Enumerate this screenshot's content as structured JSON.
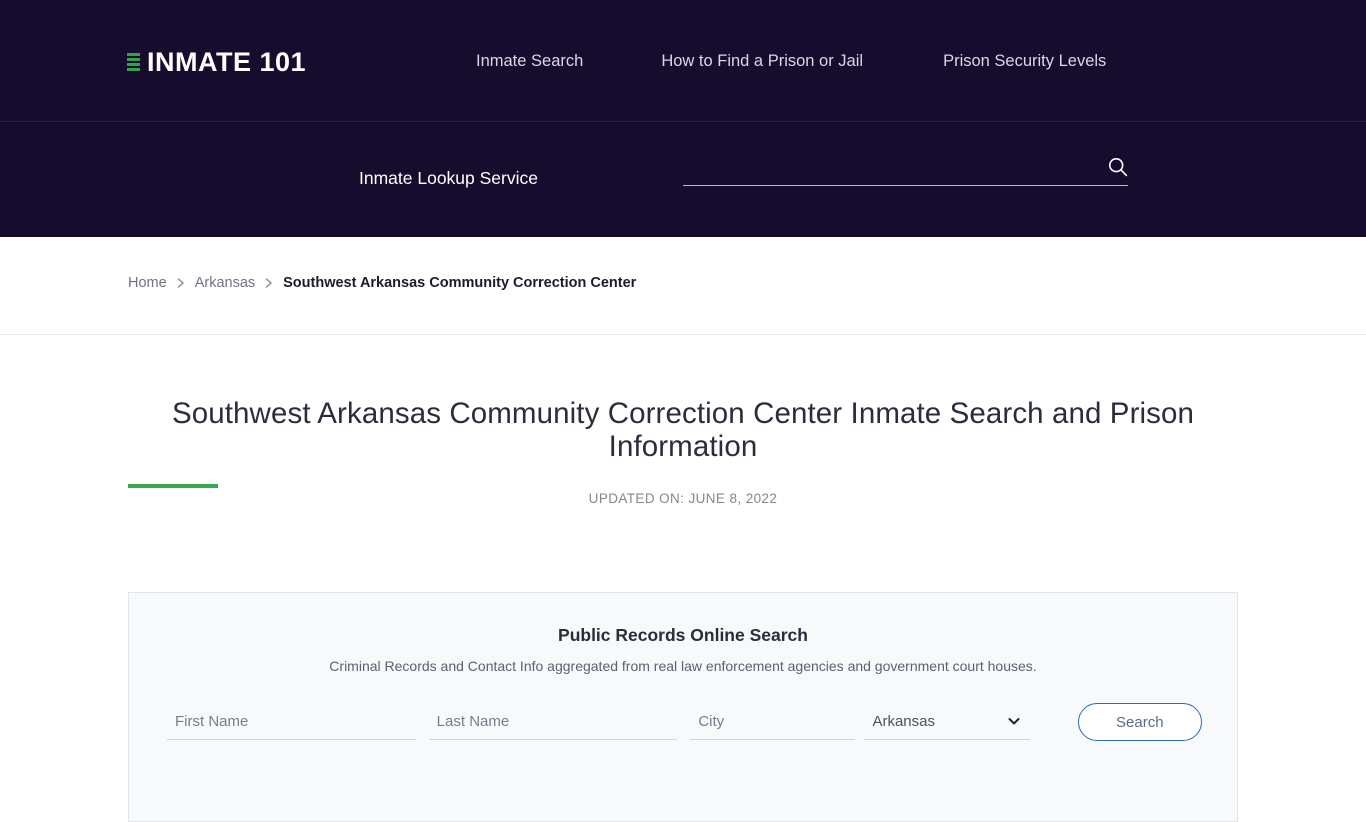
{
  "theme": {
    "header_bg": "#160d2e",
    "accent_green": "#35a84a",
    "button_blue": "#2b6cb8",
    "card_bg": "#f8f9fb"
  },
  "header": {
    "logo_text": "INMATE 101",
    "logo_icon": "prison-bars-icon",
    "nav": [
      {
        "label": "Inmate Search"
      },
      {
        "label": "How to Find a Prison or Jail"
      },
      {
        "label": "Prison Security Levels"
      }
    ]
  },
  "lookup": {
    "label": "Inmate Lookup Service",
    "input_value": "",
    "input_placeholder": "",
    "search_icon": "search-icon"
  },
  "breadcrumb": {
    "items": [
      {
        "label": "Home"
      },
      {
        "label": "Arkansas"
      }
    ],
    "separator_icon": "chevron-right-icon",
    "current": "Southwest Arkansas Community Correction Center"
  },
  "main": {
    "title": "Southwest Arkansas Community Correction Center Inmate Search and Prison Information",
    "updated": "UPDATED ON: JUNE 8, 2022"
  },
  "records_card": {
    "heading": "Public Records Online Search",
    "subheading": "Criminal Records and Contact Info aggregated from real law enforcement agencies and government court houses.",
    "first_name": {
      "value": "",
      "placeholder": "First Name"
    },
    "last_name": {
      "value": "",
      "placeholder": "Last Name"
    },
    "city": {
      "value": "",
      "placeholder": "City"
    },
    "state": {
      "selected": "Arkansas",
      "icon": "chevron-down-icon"
    },
    "search_label": "Search"
  }
}
